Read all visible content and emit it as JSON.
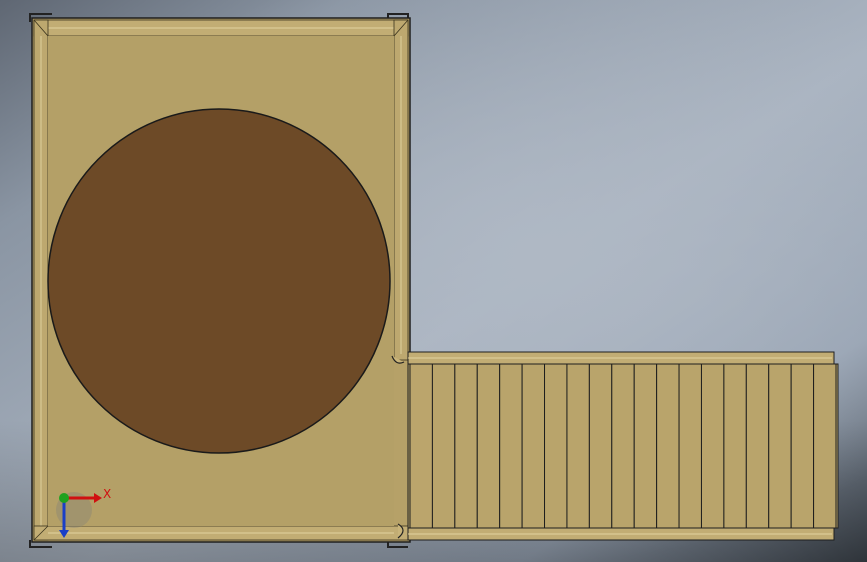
{
  "viewport": {
    "background_top": "#a9b2bf",
    "background_mid": "#9aa6b6",
    "background_bottom": "#3c424a"
  },
  "model": {
    "wood_color": "#b9a46b",
    "wood_dark": "#8f7b46",
    "outline_color": "#1a1a1a",
    "circle_color": "#6d4a27",
    "ramp_slats": 19
  },
  "triad": {
    "x_label": "X",
    "x_color": "#d01010",
    "y_color": "#1fa21f",
    "z_color": "#1a3fc8"
  }
}
